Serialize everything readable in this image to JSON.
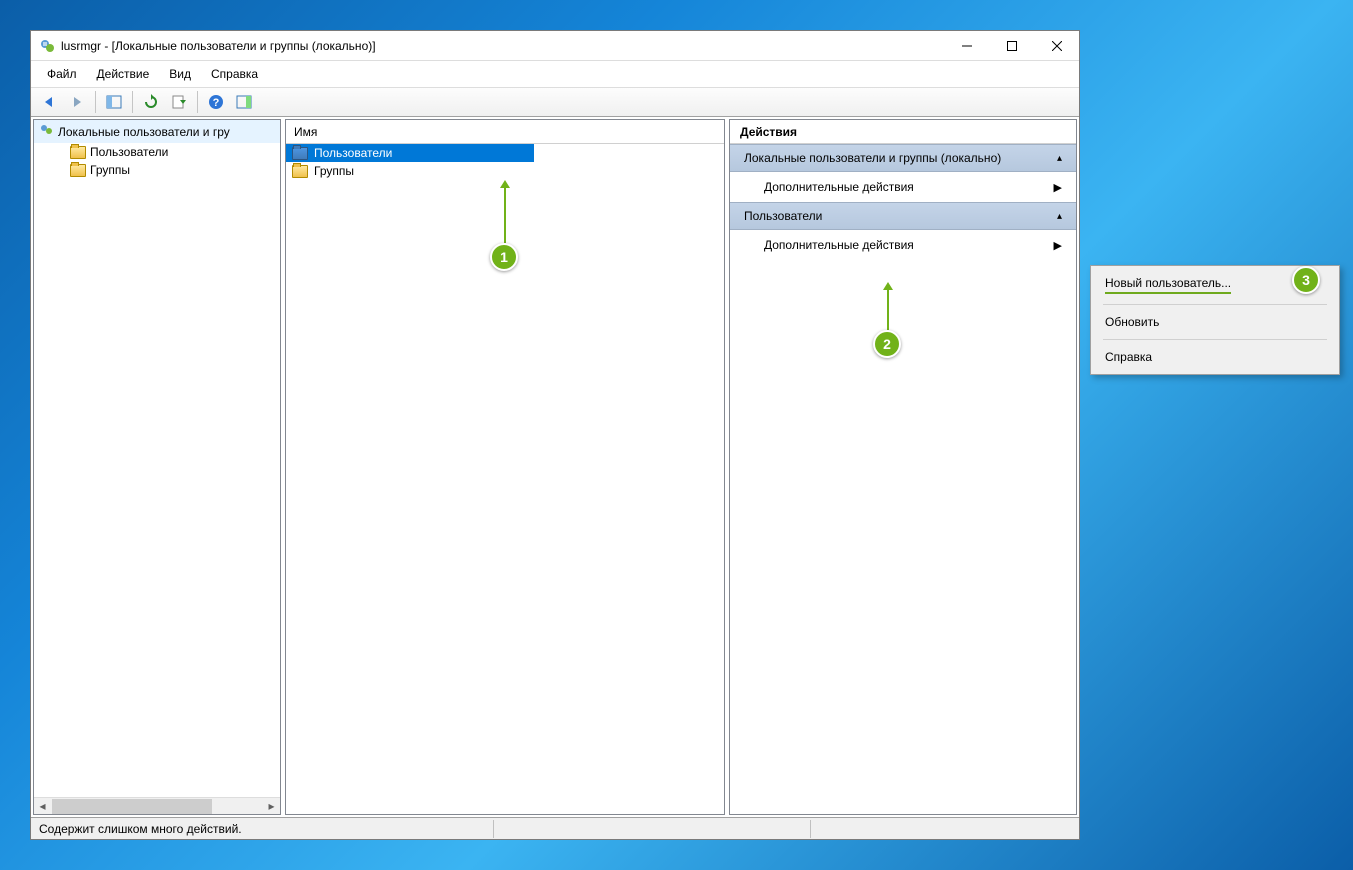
{
  "window": {
    "title": "lusrmgr - [Локальные пользователи и группы (локально)]"
  },
  "menu": {
    "file": "Файл",
    "action": "Действие",
    "view": "Вид",
    "help": "Справка"
  },
  "tree": {
    "root": "Локальные пользователи и гру",
    "users": "Пользователи",
    "groups": "Группы"
  },
  "list": {
    "header_name": "Имя",
    "items": [
      {
        "label": "Пользователи",
        "selected": true
      },
      {
        "label": "Группы",
        "selected": false
      }
    ]
  },
  "actions": {
    "header": "Действия",
    "section1": "Локальные пользователи и группы (локально)",
    "more1": "Дополнительные действия",
    "section2": "Пользователи",
    "more2": "Дополнительные действия"
  },
  "context_menu": {
    "new_user": "Новый пользователь...",
    "refresh": "Обновить",
    "help": "Справка"
  },
  "statusbar": {
    "text": "Содержит слишком много действий."
  },
  "callouts": {
    "c1": "1",
    "c2": "2",
    "c3": "3"
  }
}
